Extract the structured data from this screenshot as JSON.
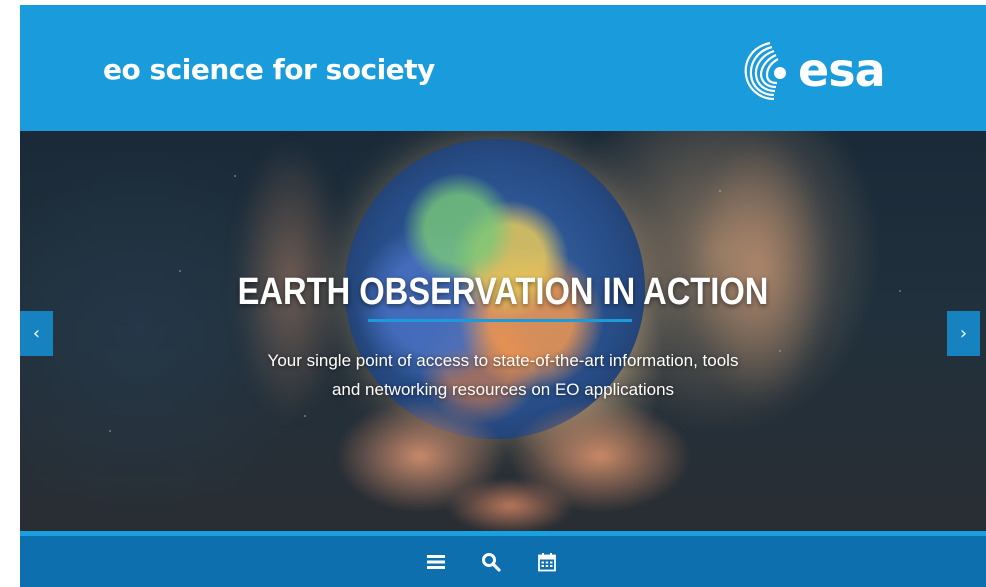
{
  "header": {
    "site_title": "eo science for society",
    "logo_text": "esa"
  },
  "hero": {
    "title": "EARTH OBSERVATION IN ACTION",
    "subtitle_line1": "Your single point of access to state-of-the-art information, tools",
    "subtitle_line2": "and networking resources on EO applications",
    "prev_label": "‹",
    "next_label": "›"
  },
  "bottom_nav": {
    "icons": [
      "menu-icon",
      "search-icon",
      "calendar-icon"
    ]
  },
  "colors": {
    "brand_blue": "#1a9bdb",
    "nav_blue": "#0d6fae",
    "arrow_blue": "#1682c0"
  }
}
